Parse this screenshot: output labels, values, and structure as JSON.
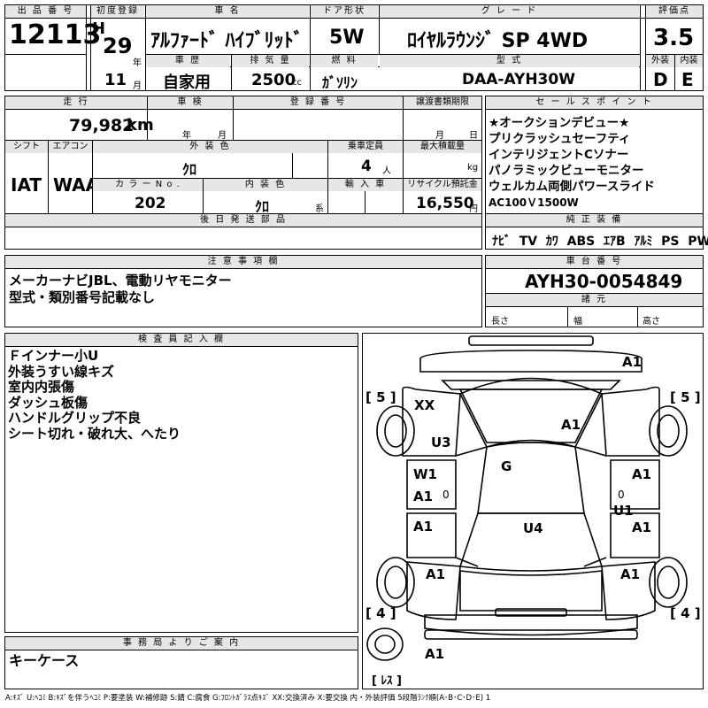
{
  "header": {
    "lot_no_label": "出 品 番 号",
    "lot_no": "12113",
    "first_reg_label": "初度登録",
    "era": "H",
    "year": "29",
    "year_unit": "年",
    "month": "11",
    "month_unit": "月",
    "car_name_label": "車 名",
    "car_name": "ｱﾙﾌｧｰﾄﾞ ﾊｲﾌﾞﾘｯﾄﾞ",
    "door_label": "ドア形状",
    "door": "5W",
    "grade_label": "グ レ ー ド",
    "grade": "ﾛｲﾔﾙﾗｳﾝｼﾞ SP 4WD",
    "score_label": "評価点",
    "score": "3.5",
    "history_label": "車 歴",
    "history": "自家用",
    "displacement_label": "排 気 量",
    "displacement": "2500",
    "displacement_unit": "cc",
    "fuel_label": "燃 料",
    "fuel": "ｶﾞｿﾘﾝ",
    "model_code_label": "型 式",
    "model_code": "DAA-AYH30W",
    "exterior_label": "外装",
    "exterior_score": "D",
    "interior_label": "内装",
    "interior_score": "E"
  },
  "row2": {
    "mileage_label": "走 行",
    "mileage": "79,982",
    "mileage_unit": "km",
    "inspection_label": "車 検",
    "year_unit": "年",
    "month_unit": "月",
    "plate_label": "登 録 番 号",
    "transfer_label": "譲渡書類期限",
    "transfer_month": "月",
    "transfer_day": "日",
    "shift_label": "シフト",
    "shift": "IAT",
    "ac_label": "エアコン",
    "ac": "WAA",
    "ext_color_label": "外 装 色",
    "ext_color": "ｸﾛ",
    "seats_label": "乗車定員",
    "seats": "4",
    "seats_unit": "人",
    "load_label": "最大積載量",
    "load_unit": "kg",
    "color_no_label": "カ ラ ー N o .",
    "color_no": "202",
    "int_color_label": "内 装 色",
    "int_color": "ｸﾛ",
    "int_color_unit": "系",
    "import_label": "輸 入 車",
    "recycle_label": "リサイクル預託金",
    "recycle": "16,550",
    "recycle_unit": "円",
    "later_parts_label": "後 日 発 送 部 品"
  },
  "sales_points": {
    "label": "セ ー ル ス ポ イ ン ト",
    "lines": [
      "★オークションデビュー★",
      "プリクラッシュセーフティ",
      "インテリジェントCソナー",
      "パノラミックビューモニター",
      "ウェルカム両側パワースライド"
    ],
    "last_line": "AC100Ｖ1500W"
  },
  "equipment": {
    "label": "純 正 装 備",
    "items": [
      "ﾅﾋﾞ",
      "TV",
      "ｶﾜ",
      "ABS",
      "ｴｱB",
      "ｱﾙﾐ",
      "PS",
      "PW"
    ]
  },
  "cautions": {
    "label": "注 意 事 項 欄",
    "lines": [
      "メーカーナビJBL、電動リヤモニター",
      "型式・類別番号記載なし"
    ]
  },
  "chassis": {
    "label": "車 台 番 号",
    "number": "AYH30-0054849",
    "spec_label": "諸 元",
    "length_label": "長さ",
    "width_label": "幅",
    "height_label": "高さ"
  },
  "inspector": {
    "label": "検 査 員 記 入 欄",
    "lines": [
      "Ｆインナー小U",
      "外装うすい線キズ",
      "室内内張傷",
      "ダッシュ板傷",
      "ハンドルグリップ不良",
      "シート切れ・破れ大、へたり"
    ]
  },
  "office": {
    "label": "事 務 局 よ り ご 案 内",
    "text": "キーケース"
  },
  "diagram": {
    "tire_tl": "[ 5 ]",
    "tire_tr": "[ 5 ]",
    "tire_bl": "[ 4 ]",
    "tire_br": "[ 4 ]",
    "spare": "[ ﾚｽ ]",
    "marks": {
      "xx": "XX",
      "u3": "U3",
      "w1": "W1",
      "a1_front_right": "A1",
      "a1_hood": "A1",
      "g": "G",
      "a1_left_front_door": "A1",
      "a1_right_front_door": "A1",
      "a1_left_rear_door": "A1",
      "a1_right_rear_door": "A1",
      "a1_left_qtr": "A1",
      "a1_right_qtr": "A1",
      "a1_left_fender": "A1",
      "u1": "U1",
      "u4": "U4",
      "a1_rear": "A1"
    },
    "zero_left": "0",
    "zero_right": "0"
  },
  "legend": "A:ｷｽﾞ U:ﾍｺﾐ B:ｷｽﾞを伴うﾍｺﾐ P:要塗装 W:補修跡 S:錆 C:腐食 G:ﾌﾛﾝﾄｶﾞﾗｽ点ｷｽﾞ XX:交換済み X:要交換 内・外装評価 5段階ﾗﾝｸ順(A･B･C･D･E) 1"
}
